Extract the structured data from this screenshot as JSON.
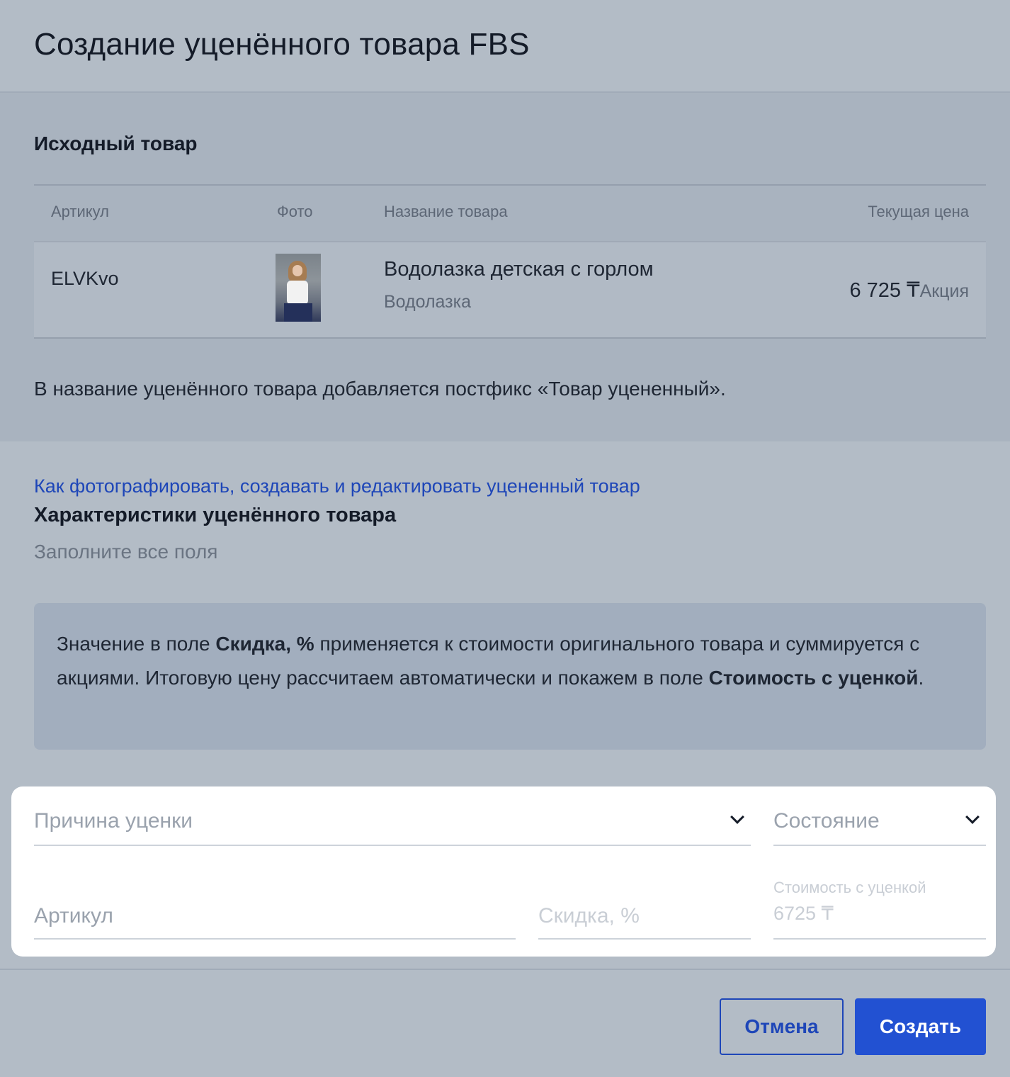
{
  "header": {
    "title": "Создание уценённого товара FBS"
  },
  "source": {
    "title": "Исходный товар",
    "columns": {
      "sku": "Артикул",
      "photo": "Фото",
      "name": "Название товара",
      "price": "Текущая цена"
    },
    "row": {
      "sku": "ELVKvo",
      "name": "Водолазка детская с горлом",
      "type": "Водолазка",
      "price": "6 725 ₸",
      "price_tag": "Акция"
    },
    "postfix_note": "В название уценённого товара добавляется постфикс «Товар уцененный»."
  },
  "chars": {
    "help_link": "Как фотографировать, создавать и редактировать уцененный товар",
    "title": "Характеристики уценённого товара",
    "fill_note": "Заполните все поля",
    "info": {
      "p1": "Значение в поле ",
      "b1": "Скидка, %",
      "p2": " применяется к стоимости оригинального товара и суммируется с акциями. Итоговую цену рассчитаем автоматически и покажем в поле ",
      "b2": "Стоимость с уценкой",
      "p3": "."
    }
  },
  "form": {
    "reason_placeholder": "Причина уценки",
    "condition_placeholder": "Состояние",
    "sku_placeholder": "Артикул",
    "discount_placeholder": "Скидка, %",
    "discounted_price_label": "Стоимость с уценкой",
    "discounted_price_value": "6725 ₸"
  },
  "footer": {
    "cancel_label": "Отмена",
    "create_label": "Создать"
  },
  "colors": {
    "accent": "#2251d2",
    "link": "#1e46b8"
  }
}
